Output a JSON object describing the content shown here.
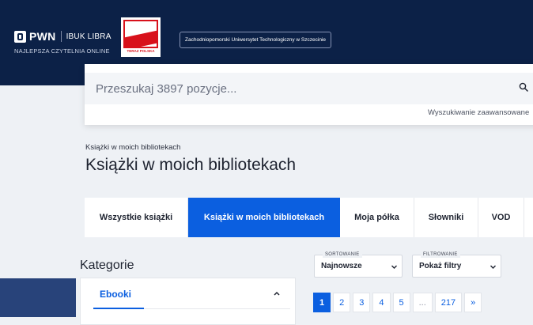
{
  "header": {
    "logo_pwn": "PWN",
    "logo_ibuk": "IBUK LIBRA",
    "tagline": "NAJLEPSZA CZYTELNIA ONLINE",
    "teraz_polska": "TERAZ POLSKA",
    "university": "Zachodniopomorski Uniwersytet Technologiczny w Szczecinie",
    "bg_color": "#0c2147"
  },
  "search": {
    "placeholder": "Przeszukaj 3897 pozycje...",
    "advanced_link": "Wyszukiwanie zaawansowane"
  },
  "breadcrumb": "Książki w moich bibliotekach",
  "page_title": "Książki w moich bibliotekach",
  "tabs": [
    {
      "label": "Wszystkie książki",
      "active": false
    },
    {
      "label": "Książki w moich bibliotekach",
      "active": true
    },
    {
      "label": "Moja półka",
      "active": false
    },
    {
      "label": "Słowniki",
      "active": false
    },
    {
      "label": "VOD",
      "active": false
    }
  ],
  "sidebar": {
    "title": "Kategorie",
    "category": "Ebooki"
  },
  "sorting": {
    "label": "SORTOWANIE",
    "value": "Najnowsze"
  },
  "filtering": {
    "label": "FILTROWANIE",
    "value": "Pokaż filtry"
  },
  "pagination": {
    "pages": [
      "1",
      "2",
      "3",
      "4",
      "5",
      "...",
      "217"
    ],
    "next": "»",
    "current": "1"
  },
  "accent_color": "#0b5fe0"
}
